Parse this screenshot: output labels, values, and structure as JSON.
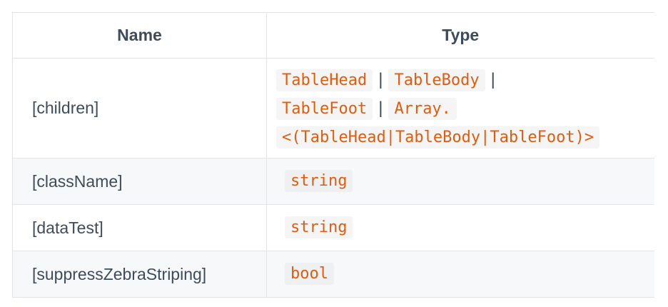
{
  "table": {
    "headers": {
      "name": "Name",
      "type": "Type"
    },
    "rows": [
      {
        "name": "[children]",
        "type_parts": {
          "table_head": "TableHead",
          "sep1": "|",
          "table_body": "TableBody",
          "sep2": "|",
          "table_foot": "TableFoot",
          "sep3": "|",
          "array_prefix": "Array.",
          "array_generic": "<(TableHead|TableBody|TableFoot)>"
        }
      },
      {
        "name": "[className]",
        "type": "string"
      },
      {
        "name": "[dataTest]",
        "type": "string"
      },
      {
        "name": "[suppressZebraStriping]",
        "type": "bool"
      }
    ]
  },
  "colors": {
    "code_text": "#e05d10",
    "body_text": "#3e4c59",
    "stripe_bg": "#f6f8fa",
    "border": "#e1e4e8"
  }
}
